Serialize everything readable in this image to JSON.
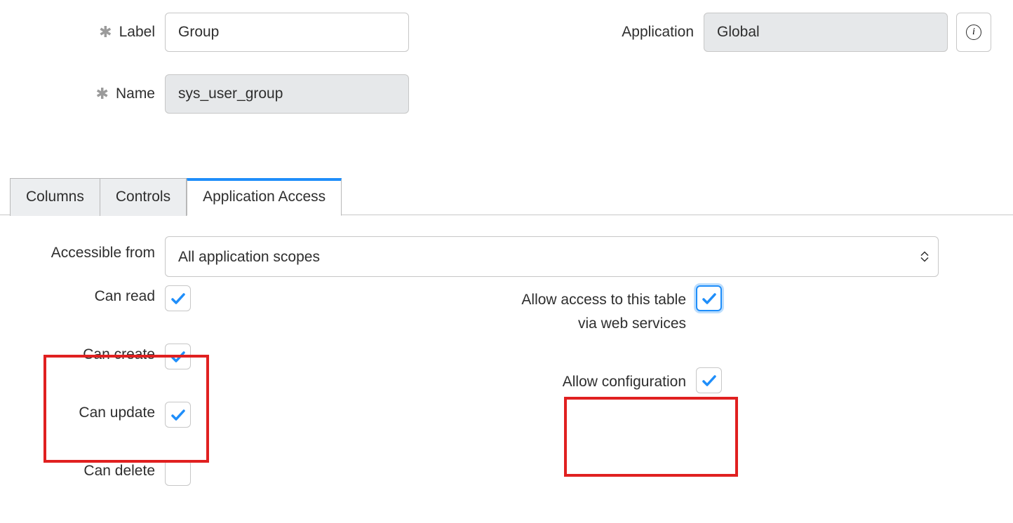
{
  "form": {
    "label_field_label": "Label",
    "label_value": "Group",
    "name_field_label": "Name",
    "name_value": "sys_user_group",
    "application_label": "Application",
    "application_value": "Global"
  },
  "tabs": {
    "columns": "Columns",
    "controls": "Controls",
    "app_access": "Application Access"
  },
  "access": {
    "accessible_from_label": "Accessible from",
    "accessible_from_value": "All application scopes",
    "can_read": "Can read",
    "can_create": "Can create",
    "can_update": "Can update",
    "can_delete": "Can delete",
    "allow_web_services": "Allow access to this table via web services",
    "allow_configuration": "Allow configuration"
  }
}
